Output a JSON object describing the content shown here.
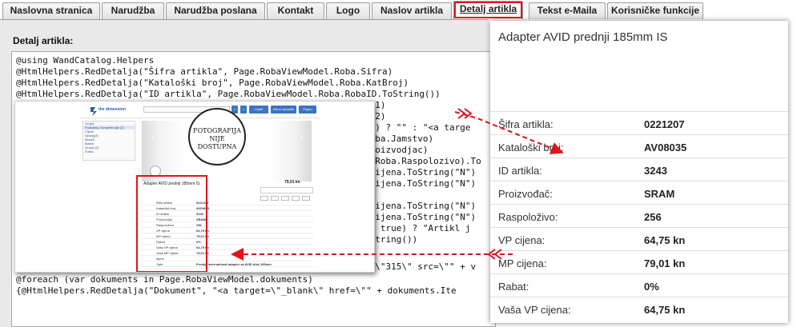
{
  "tabs": [
    {
      "label": "Naslovna stranica",
      "active": false
    },
    {
      "label": "Narudžba",
      "active": false
    },
    {
      "label": "Narudžba poslana",
      "active": false
    },
    {
      "label": "Kontakt",
      "active": false
    },
    {
      "label": "Logo",
      "active": false
    },
    {
      "label": "Naslov artikla",
      "active": false
    },
    {
      "label": "Detalj artikla",
      "active": true
    },
    {
      "label": "Tekst e-Maila",
      "active": false
    },
    {
      "label": "Korisničke funkcije",
      "active": false
    }
  ],
  "section_label": "Detalj artikla:",
  "code": {
    "lines": [
      "@using WandCatalog.Helpers",
      "@HtmlHelpers.RedDetalja(\"Šifra artikla\", Page.RobaViewModel.Roba.Sifra)",
      "@HtmlHelpers.RedDetalja(\"Kataloški broj\", Page.RobaViewModel.Roba.KatBroj)",
      "@HtmlHelpers.RedDetalja(\"ID artikla\", Page.RobaViewModel.Roba.RobaID.ToString())",
      "iv1)",
      "iv2)",
      "\"\") ? \"\" : \"<a targe",
      "Roba.Jamstvo)",
      "Proizvodjac)",
      "l.Roba.Raspolozivo).To",
      "PCijena.ToString(\"N\")",
      "PCijena.ToString(\"N\")",
      "\")",
      "PCijena.ToString(\"N\")",
      "PCijena.ToString(\"N\")",
      "== true) ? \"Artikl j",
      "oString())",
      "t=\\\"315\\\" src=\\\"\" + v",
      "@foreach (var dokuments in Page.RobaViewModel.dokuments)",
      "{@HtmlHelpers.RedDetalja(\"Dokument\", \"<a target=\\\"_blank\\\" href=\\\"\" + dokuments.Ite"
    ]
  },
  "inset": {
    "logo_text": "the dimension",
    "buttons": [
      "Uvjeti",
      "Zbirni narudžbi",
      "Pojam"
    ],
    "sidebar_items": [
      "Grupa",
      "Podkateg. kompetencija (2)",
      "Cijene",
      "Opseg(4)",
      "Modeli",
      "Marke",
      "Grupa (2)",
      "Žurba"
    ],
    "photo_text": "FOTOGRAFIJA NIJE DOSTUPNA",
    "product_title": "Adapter AVID prednji 185mm IS",
    "price": "79,01 kn",
    "table_rows": [
      {
        "k": "Šifra artikla",
        "v": "0221207"
      },
      {
        "k": "Kataloški broj",
        "v": "AV08035"
      },
      {
        "k": "ID artikla",
        "v": "3243"
      },
      {
        "k": "Proizvođač",
        "v": "SRAM"
      },
      {
        "k": "Raspoloživo",
        "v": "256"
      },
      {
        "k": "VP cijena",
        "v": "64,75 kn"
      },
      {
        "k": "MP cijena",
        "v": "79,01 kn"
      },
      {
        "k": "Rabat",
        "v": "0%"
      },
      {
        "k": "Vaša VP cijena",
        "v": "64,75 kn"
      },
      {
        "k": "Vaša MP cijena",
        "v": "79,01 kn"
      },
      {
        "k": "Mjere",
        "v": ""
      },
      {
        "k": "Opis",
        "v": "Prednji international adapter za AVID disk 185mm"
      }
    ]
  },
  "zoom": {
    "title": "Adapter AVID prednji 185mm IS",
    "rows": [
      {
        "k": "Šifra artikla:",
        "v": "0221207"
      },
      {
        "k": "Kataloški broj:",
        "v": "AV08035"
      },
      {
        "k": "ID artikla:",
        "v": "3243"
      },
      {
        "k": "Proizvođač:",
        "v": "SRAM"
      },
      {
        "k": "Raspoloživo:",
        "v": "256"
      },
      {
        "k": "VP cijena:",
        "v": "64,75 kn"
      },
      {
        "k": "MP cijena:",
        "v": "79,01 kn"
      },
      {
        "k": "Rabat:",
        "v": "0%"
      },
      {
        "k": "Vaša VP cijena:",
        "v": "64,75 kn"
      }
    ]
  },
  "colors": {
    "highlight": "#e0121b",
    "tab_bg": "#e3e3e3",
    "frame_bg": "#e9e9e9"
  }
}
